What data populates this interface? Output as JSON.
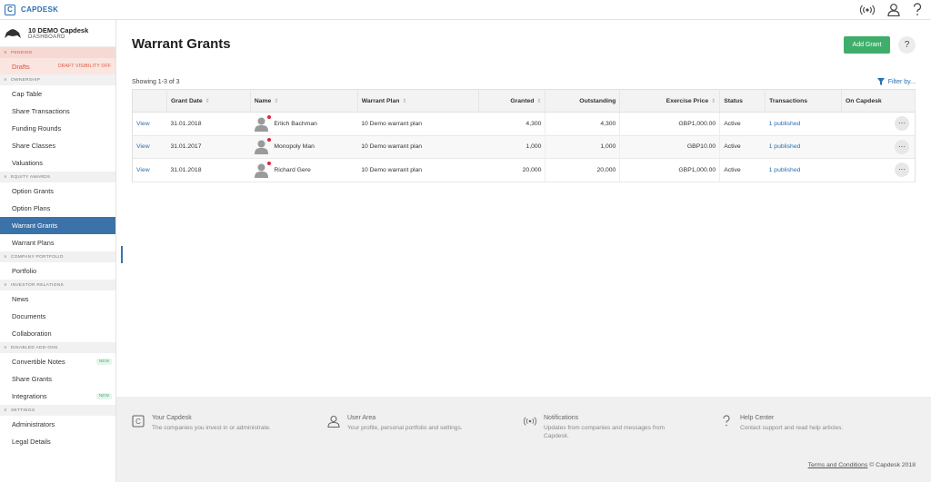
{
  "app": {
    "brand": "CAPDESK",
    "logo_letter": "C"
  },
  "company": {
    "name": "10 DEMO Capdesk",
    "sub": "DASHBOARD"
  },
  "sidebar": {
    "pending": {
      "label": "PENDING",
      "drafts": "Drafts",
      "drafts_tag": "DRAFT VISIBILITY OFF"
    },
    "ownership": {
      "label": "OWNERSHIP",
      "items": [
        "Cap Table",
        "Share Transactions",
        "Funding Rounds",
        "Share Classes",
        "Valuations"
      ]
    },
    "equity": {
      "label": "EQUITY AWARDS",
      "items": [
        "Option Grants",
        "Option Plans",
        "Warrant Grants",
        "Warrant Plans"
      ]
    },
    "portfolio": {
      "label": "COMPANY PORTFOLIO",
      "items": [
        "Portfolio"
      ]
    },
    "investor": {
      "label": "INVESTOR RELATIONS",
      "items": [
        "News",
        "Documents",
        "Collaboration"
      ]
    },
    "addons": {
      "label": "DISABLED ADD-ONS",
      "items": [
        "Convertible Notes",
        "Share Grants",
        "Integrations"
      ],
      "new_badge": "NEW"
    },
    "settings": {
      "label": "SETTINGS",
      "items": [
        "Administrators",
        "Legal Details"
      ]
    }
  },
  "main": {
    "title": "Warrant Grants",
    "add_button": "Add Grant",
    "help": "?",
    "showing": "Showing 1-3 of 3",
    "filter": "Filter by...",
    "columns": {
      "grant_date": "Grant Date",
      "name": "Name",
      "plan": "Warrant Plan",
      "granted": "Granted",
      "outstanding": "Outstanding",
      "price": "Exercise Price",
      "status": "Status",
      "transactions": "Transactions",
      "on_capdesk": "On Capdesk"
    },
    "rows": [
      {
        "view": "View",
        "date": "31.01.2018",
        "name": "Erlich Bachman",
        "plan": "10 Demo warrant plan",
        "granted": "4,300",
        "outstanding": "4,300",
        "price": "GBP1,000.00",
        "status": "Active",
        "transactions": "1 published",
        "more": "···"
      },
      {
        "view": "View",
        "date": "31.01.2017",
        "name": "Monopoly Man",
        "plan": "10 Demo warrant plan",
        "granted": "1,000",
        "outstanding": "1,000",
        "price": "GBP10.00",
        "status": "Active",
        "transactions": "1 published",
        "more": "···"
      },
      {
        "view": "View",
        "date": "31.01.2018",
        "name": "Richard Gere",
        "plan": "10 Demo warrant plan",
        "granted": "20,000",
        "outstanding": "20,000",
        "price": "GBP1,000.00",
        "status": "Active",
        "transactions": "1 published",
        "more": "···"
      }
    ]
  },
  "footer": {
    "your_capdesk": {
      "title": "Your Capdesk",
      "desc": "The companies you invest in or administrate."
    },
    "user_area": {
      "title": "User Area",
      "desc": "Your profile, personal portfolio and settings."
    },
    "notifications": {
      "title": "Notifications",
      "desc": "Updates from companies and messages from Capdesk."
    },
    "help_center": {
      "title": "Help Center",
      "desc": "Contact support and read help articles."
    },
    "terms": "Terms and Conditions",
    "copyright": "© Capdesk 2018"
  },
  "colors": {
    "accent": "#2a6fb0",
    "active_nav": "#3b73a8",
    "add_button": "#3fae6a",
    "pending": "#d9553a",
    "notification_dot": "#e2263a"
  },
  "icons": [
    "signal-icon",
    "user-icon",
    "question-icon",
    "filter-icon",
    "chevron-down-icon",
    "avatar-icon",
    "capdesk-icon",
    "bell-icon"
  ]
}
